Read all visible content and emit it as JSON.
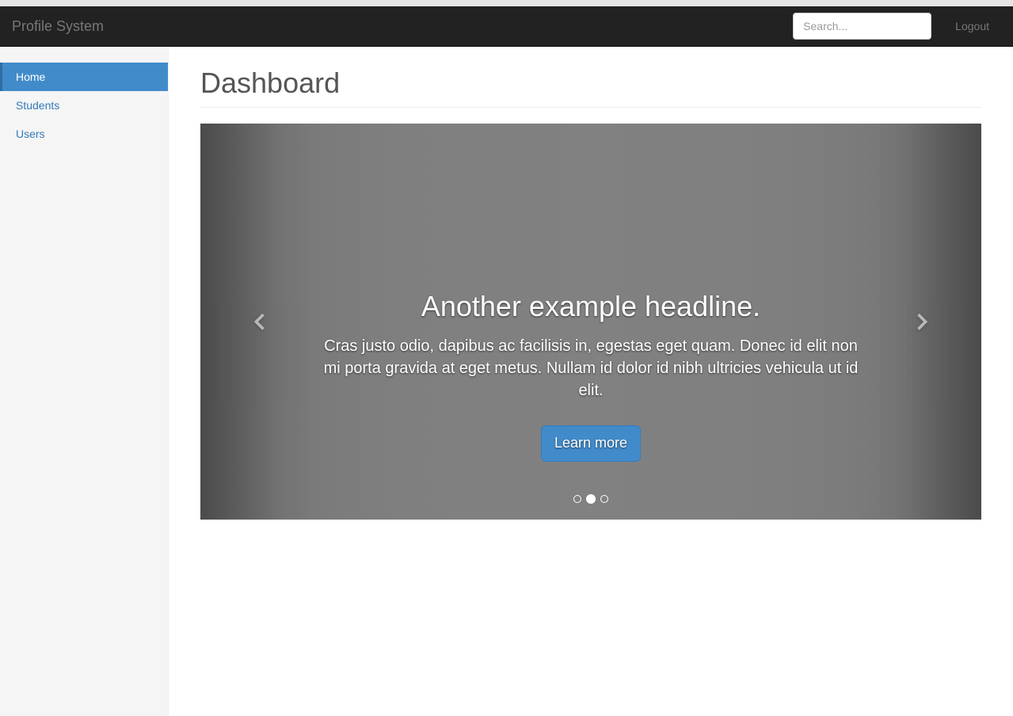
{
  "navbar": {
    "brand": "Profile System",
    "search_placeholder": "Search...",
    "logout_label": "Logout"
  },
  "sidebar": {
    "items": [
      {
        "label": "Home",
        "active": true
      },
      {
        "label": "Students",
        "active": false
      },
      {
        "label": "Users",
        "active": false
      }
    ]
  },
  "page": {
    "title": "Dashboard"
  },
  "carousel": {
    "active_index": 1,
    "indicator_count": 3,
    "slide": {
      "headline": "Another example headline.",
      "body": "Cras justo odio, dapibus ac facilisis in, egestas eget quam. Donec id elit non mi porta gravida at eget metus. Nullam id dolor id nibh ultricies vehicula ut id elit.",
      "button_label": "Learn more"
    }
  }
}
